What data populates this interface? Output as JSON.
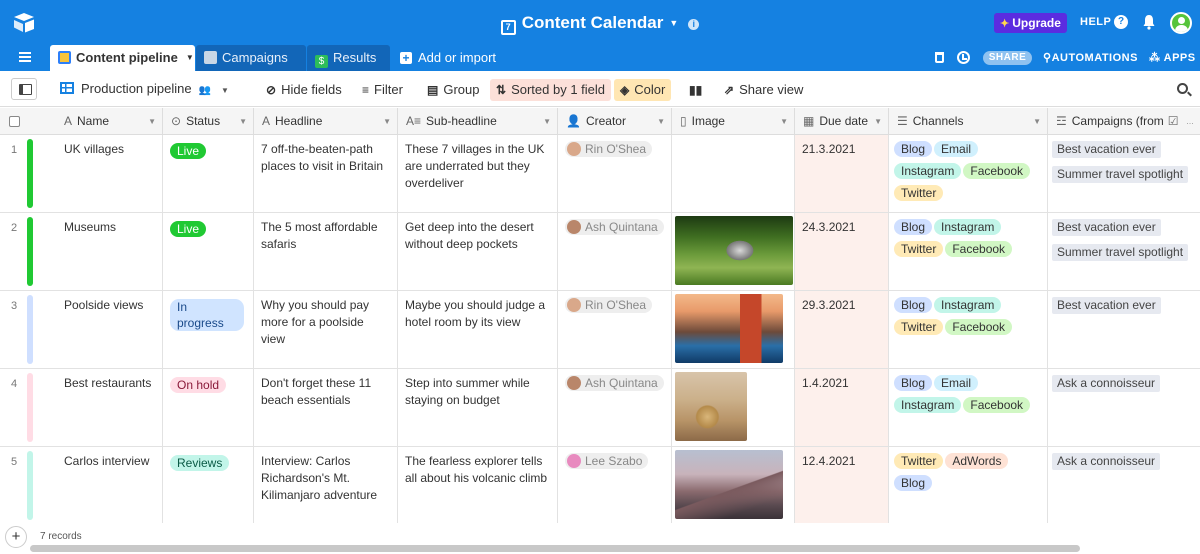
{
  "app": {
    "title": "Content Calendar",
    "upgrade": "Upgrade",
    "help": "HELP"
  },
  "tabs": [
    {
      "label": "Content pipeline"
    },
    {
      "label": "Campaigns"
    },
    {
      "label": "Results"
    }
  ],
  "toolbar": {
    "add_import": "Add or import",
    "share": "SHARE",
    "automations": "AUTOMATIONS",
    "apps": "APPS"
  },
  "view": {
    "name": "Production pipeline",
    "hide_fields": "Hide fields",
    "filter": "Filter",
    "group": "Group",
    "sorted": "Sorted by 1 field",
    "color": "Color",
    "share_view": "Share view"
  },
  "columns": {
    "name": "Name",
    "status": "Status",
    "headline": "Headline",
    "subheadline": "Sub-headline",
    "creator": "Creator",
    "image": "Image",
    "due_date": "Due date",
    "channels": "Channels",
    "campaigns": "Campaigns (from"
  },
  "rows": [
    {
      "num": "1",
      "name": "UK villages",
      "status": "Live",
      "headline": "7 off-the-beaten-path places to visit in Britain",
      "sub": "These 7 villages in the UK are underrated but they overdeliver",
      "creator": "Rin O'Shea",
      "due": "21.3.2021",
      "channels": [
        "Blog",
        "Email",
        "Instagram",
        "Facebook",
        "Twitter"
      ],
      "campaigns": [
        "Best vacation ever",
        "Summer travel spotlight"
      ],
      "color": "#20c933"
    },
    {
      "num": "2",
      "name": "Museums",
      "status": "Live",
      "headline": "The 5 most affordable safaris",
      "sub": "Get deep into the desert without deep pockets",
      "creator": "Ash Quintana",
      "due": "24.3.2021",
      "channels": [
        "Blog",
        "Instagram",
        "Twitter",
        "Facebook"
      ],
      "campaigns": [
        "Best vacation ever",
        "Summer travel spotlight"
      ],
      "color": "#20c933"
    },
    {
      "num": "3",
      "name": "Poolside views",
      "status": "In progress",
      "headline": "Why you should pay more for a poolside view",
      "sub": "Maybe you should judge a hotel room by its view",
      "creator": "Rin O'Shea",
      "due": "29.3.2021",
      "channels": [
        "Blog",
        "Instagram",
        "Twitter",
        "Facebook"
      ],
      "campaigns": [
        "Best vacation ever"
      ],
      "color": "#cfdfff"
    },
    {
      "num": "4",
      "name": "Best restaurants",
      "status": "On hold",
      "headline": "Don't forget these 11 beach essentials",
      "sub": "Step into summer while staying on budget",
      "creator": "Ash Quintana",
      "due": "1.4.2021",
      "channels": [
        "Blog",
        "Email",
        "Instagram",
        "Facebook"
      ],
      "campaigns": [
        "Ask a connoisseur"
      ],
      "color": "#ffdce5"
    },
    {
      "num": "5",
      "name": "Carlos interview",
      "status": "Reviews",
      "headline": "Interview: Carlos Richardson's Mt. Kilimanjaro adventure",
      "sub": "The fearless explorer tells all about his volcanic climb",
      "creator": "Lee Szabo",
      "due": "12.4.2021",
      "channels": [
        "Twitter",
        "AdWords",
        "Blog"
      ],
      "campaigns": [
        "Ask a connoisseur"
      ],
      "color": "#c2f5e9"
    }
  ],
  "footer": {
    "records": "7 records"
  },
  "colors": {
    "topbar": "#1581e1",
    "Live": "#20c933",
    "In progress": "#d0e4ff",
    "On hold": "#ffdce5",
    "Reviews": "#c2f5e9",
    "Blog": "#cfdfff",
    "Email": "#d0f0fd",
    "Instagram": "#c2f5e9",
    "Facebook": "#d1f7c4",
    "Twitter": "#ffeab6",
    "AdWords": "#fee2d5"
  }
}
